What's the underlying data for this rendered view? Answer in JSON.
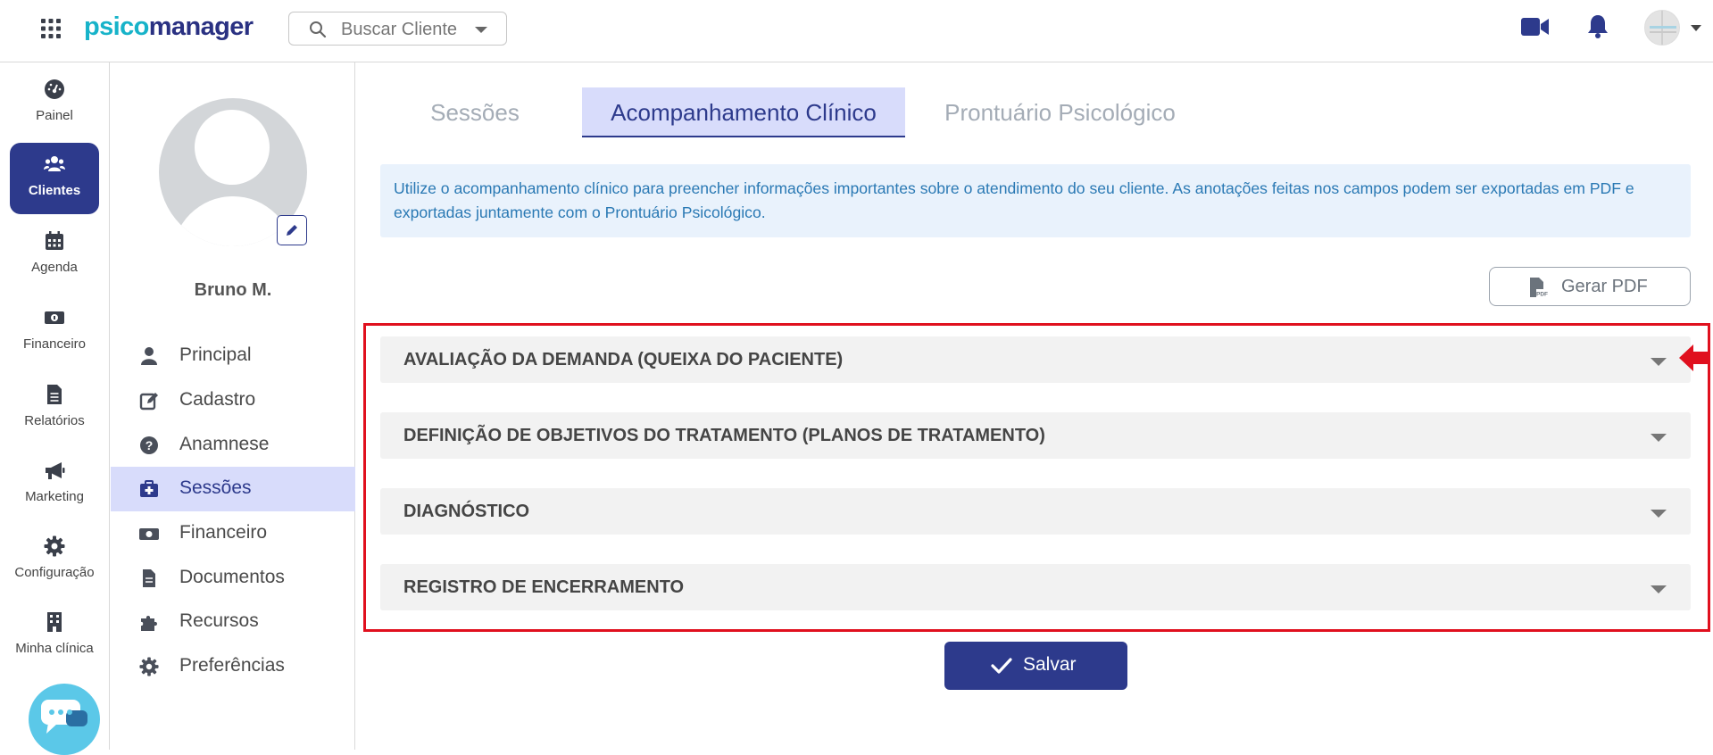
{
  "header": {
    "logo_part1": "psico",
    "logo_part2": "manager",
    "search_placeholder": "Buscar Cliente",
    "icons": [
      "apps-grid-icon",
      "search-icon",
      "video-camera-icon",
      "bell-icon",
      "user-avatar"
    ]
  },
  "leftnav": {
    "items": [
      {
        "label": "Painel",
        "icon": "dashboard-icon"
      },
      {
        "label": "Clientes",
        "icon": "users-icon",
        "active": true
      },
      {
        "label": "Agenda",
        "icon": "calendar-icon"
      },
      {
        "label": "Financeiro",
        "icon": "money-icon"
      },
      {
        "label": "Relatórios",
        "icon": "document-icon"
      },
      {
        "label": "Marketing",
        "icon": "megaphone-icon"
      },
      {
        "label": "Configuração",
        "icon": "gear-icon"
      },
      {
        "label": "Minha clínica",
        "icon": "building-icon"
      }
    ]
  },
  "client": {
    "name": "Bruno M.",
    "menu": [
      {
        "label": "Principal",
        "icon": "user-icon"
      },
      {
        "label": "Cadastro",
        "icon": "edit-icon"
      },
      {
        "label": "Anamnese",
        "icon": "question-icon"
      },
      {
        "label": "Sessões",
        "icon": "medkit-icon",
        "active": true
      },
      {
        "label": "Financeiro",
        "icon": "money-icon"
      },
      {
        "label": "Documentos",
        "icon": "file-icon"
      },
      {
        "label": "Recursos",
        "icon": "puzzle-icon"
      },
      {
        "label": "Preferências",
        "icon": "gear-icon"
      }
    ]
  },
  "tabs": [
    {
      "label": "Sessões"
    },
    {
      "label": "Acompanhamento Clínico",
      "active": true
    },
    {
      "label": "Prontuário Psicológico"
    }
  ],
  "info_text": "Utilize o acompanhamento clínico para preencher informações importantes sobre o atendimento do seu cliente. As anotações feitas nos campos podem ser exportadas em PDF e exportadas juntamente com o Prontuário Psicológico.",
  "pdf_button": "Gerar PDF",
  "accordions": [
    {
      "title": "AVALIAÇÃO DA DEMANDA (QUEIXA DO PACIENTE)"
    },
    {
      "title": "DEFINIÇÃO DE OBJETIVOS DO TRATAMENTO (PLANOS DE TRATAMENTO)"
    },
    {
      "title": "DIAGNÓSTICO"
    },
    {
      "title": "REGISTRO DE ENCERRAMENTO"
    }
  ],
  "save_button": "Salvar",
  "colors": {
    "primary": "#2d3a8c",
    "active_bg": "#d8dcfb",
    "info_bg": "#e9f2fc",
    "info_text": "#2a79b4",
    "highlight": "#e0101e",
    "logo_cyan": "#17b3c9"
  }
}
